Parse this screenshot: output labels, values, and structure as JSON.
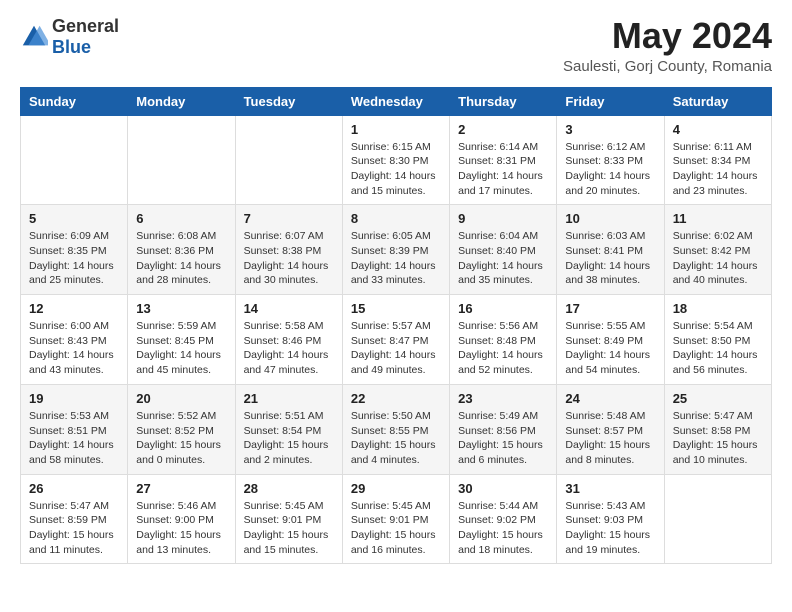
{
  "header": {
    "logo": {
      "general": "General",
      "blue": "Blue"
    },
    "title": "May 2024",
    "subtitle": "Saulesti, Gorj County, Romania"
  },
  "weekdays": [
    "Sunday",
    "Monday",
    "Tuesday",
    "Wednesday",
    "Thursday",
    "Friday",
    "Saturday"
  ],
  "weeks": [
    [
      null,
      null,
      null,
      {
        "day": 1,
        "sunrise": "6:15 AM",
        "sunset": "8:30 PM",
        "daylight": "14 hours and 15 minutes."
      },
      {
        "day": 2,
        "sunrise": "6:14 AM",
        "sunset": "8:31 PM",
        "daylight": "14 hours and 17 minutes."
      },
      {
        "day": 3,
        "sunrise": "6:12 AM",
        "sunset": "8:33 PM",
        "daylight": "14 hours and 20 minutes."
      },
      {
        "day": 4,
        "sunrise": "6:11 AM",
        "sunset": "8:34 PM",
        "daylight": "14 hours and 23 minutes."
      }
    ],
    [
      {
        "day": 5,
        "sunrise": "6:09 AM",
        "sunset": "8:35 PM",
        "daylight": "14 hours and 25 minutes."
      },
      {
        "day": 6,
        "sunrise": "6:08 AM",
        "sunset": "8:36 PM",
        "daylight": "14 hours and 28 minutes."
      },
      {
        "day": 7,
        "sunrise": "6:07 AM",
        "sunset": "8:38 PM",
        "daylight": "14 hours and 30 minutes."
      },
      {
        "day": 8,
        "sunrise": "6:05 AM",
        "sunset": "8:39 PM",
        "daylight": "14 hours and 33 minutes."
      },
      {
        "day": 9,
        "sunrise": "6:04 AM",
        "sunset": "8:40 PM",
        "daylight": "14 hours and 35 minutes."
      },
      {
        "day": 10,
        "sunrise": "6:03 AM",
        "sunset": "8:41 PM",
        "daylight": "14 hours and 38 minutes."
      },
      {
        "day": 11,
        "sunrise": "6:02 AM",
        "sunset": "8:42 PM",
        "daylight": "14 hours and 40 minutes."
      }
    ],
    [
      {
        "day": 12,
        "sunrise": "6:00 AM",
        "sunset": "8:43 PM",
        "daylight": "14 hours and 43 minutes."
      },
      {
        "day": 13,
        "sunrise": "5:59 AM",
        "sunset": "8:45 PM",
        "daylight": "14 hours and 45 minutes."
      },
      {
        "day": 14,
        "sunrise": "5:58 AM",
        "sunset": "8:46 PM",
        "daylight": "14 hours and 47 minutes."
      },
      {
        "day": 15,
        "sunrise": "5:57 AM",
        "sunset": "8:47 PM",
        "daylight": "14 hours and 49 minutes."
      },
      {
        "day": 16,
        "sunrise": "5:56 AM",
        "sunset": "8:48 PM",
        "daylight": "14 hours and 52 minutes."
      },
      {
        "day": 17,
        "sunrise": "5:55 AM",
        "sunset": "8:49 PM",
        "daylight": "14 hours and 54 minutes."
      },
      {
        "day": 18,
        "sunrise": "5:54 AM",
        "sunset": "8:50 PM",
        "daylight": "14 hours and 56 minutes."
      }
    ],
    [
      {
        "day": 19,
        "sunrise": "5:53 AM",
        "sunset": "8:51 PM",
        "daylight": "14 hours and 58 minutes."
      },
      {
        "day": 20,
        "sunrise": "5:52 AM",
        "sunset": "8:52 PM",
        "daylight": "15 hours and 0 minutes."
      },
      {
        "day": 21,
        "sunrise": "5:51 AM",
        "sunset": "8:54 PM",
        "daylight": "15 hours and 2 minutes."
      },
      {
        "day": 22,
        "sunrise": "5:50 AM",
        "sunset": "8:55 PM",
        "daylight": "15 hours and 4 minutes."
      },
      {
        "day": 23,
        "sunrise": "5:49 AM",
        "sunset": "8:56 PM",
        "daylight": "15 hours and 6 minutes."
      },
      {
        "day": 24,
        "sunrise": "5:48 AM",
        "sunset": "8:57 PM",
        "daylight": "15 hours and 8 minutes."
      },
      {
        "day": 25,
        "sunrise": "5:47 AM",
        "sunset": "8:58 PM",
        "daylight": "15 hours and 10 minutes."
      }
    ],
    [
      {
        "day": 26,
        "sunrise": "5:47 AM",
        "sunset": "8:59 PM",
        "daylight": "15 hours and 11 minutes."
      },
      {
        "day": 27,
        "sunrise": "5:46 AM",
        "sunset": "9:00 PM",
        "daylight": "15 hours and 13 minutes."
      },
      {
        "day": 28,
        "sunrise": "5:45 AM",
        "sunset": "9:01 PM",
        "daylight": "15 hours and 15 minutes."
      },
      {
        "day": 29,
        "sunrise": "5:45 AM",
        "sunset": "9:01 PM",
        "daylight": "15 hours and 16 minutes."
      },
      {
        "day": 30,
        "sunrise": "5:44 AM",
        "sunset": "9:02 PM",
        "daylight": "15 hours and 18 minutes."
      },
      {
        "day": 31,
        "sunrise": "5:43 AM",
        "sunset": "9:03 PM",
        "daylight": "15 hours and 19 minutes."
      },
      null
    ]
  ]
}
